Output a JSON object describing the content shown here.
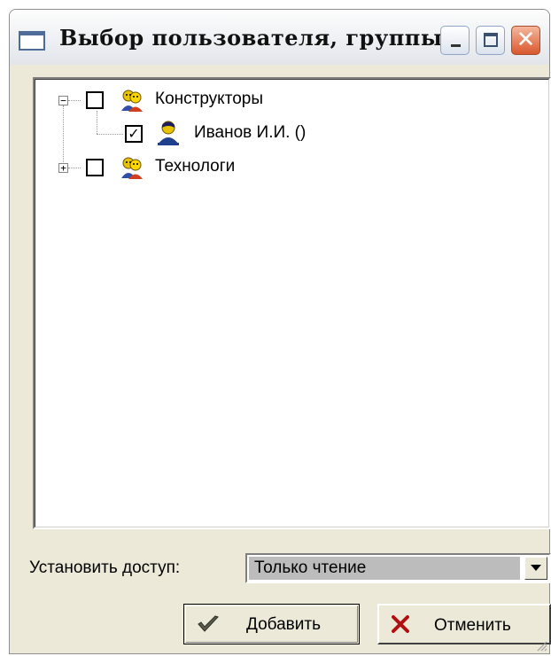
{
  "window": {
    "title": "Выбор пользователя, группы",
    "icons": {
      "app": "window-icon",
      "minimize": "minimize-icon",
      "maximize": "maximize-icon",
      "close": "close-icon"
    }
  },
  "tree": {
    "nodes": [
      {
        "label": "Конструкторы",
        "type": "group",
        "icon": "group-users-icon",
        "expander": "minus",
        "checked": false
      },
      {
        "label": "Иванов И.И. ()",
        "type": "user",
        "icon": "user-icon",
        "checked": true
      },
      {
        "label": "Технологи",
        "type": "group",
        "icon": "group-users-icon",
        "expander": "plus",
        "checked": false
      }
    ]
  },
  "access": {
    "label": "Установить доступ:",
    "selected": "Только чтение"
  },
  "buttons": {
    "add_label": "Добавить",
    "add_icon": "checkmark-icon",
    "cancel_label": "Отменить",
    "cancel_icon": "cross-icon"
  },
  "colors": {
    "dialog_bg": "#ece9d8",
    "close_button": "#d9572e",
    "selection_bg": "#bcbcbc"
  }
}
